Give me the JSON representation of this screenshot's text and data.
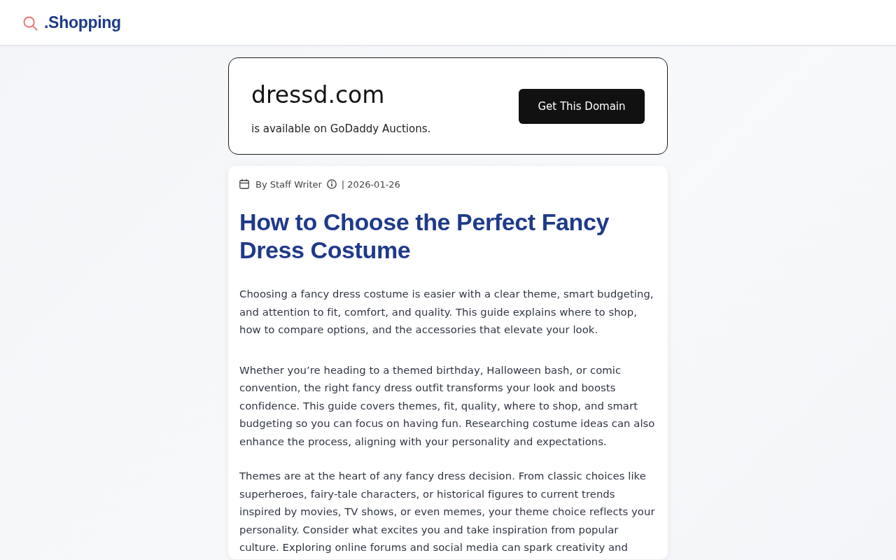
{
  "header": {
    "logo_text": ".Shopping"
  },
  "domain_banner": {
    "domain": "dressd.com",
    "subtitle": "is available on GoDaddy Auctions.",
    "button": "Get This Domain"
  },
  "article": {
    "author": "By Staff Writer",
    "date": "| 2026-01-26",
    "title": "How to Choose the Perfect Fancy Dress Costume",
    "summary": "Choosing a fancy dress costume is easier with a clear theme, smart budgeting, and attention to fit, comfort, and quality. This guide explains where to shop, how to compare options, and the accessories that elevate your look.",
    "paragraphs": [
      "Whether you’re heading to a themed birthday, Halloween bash, or comic convention, the right fancy dress outfit transforms your look and boosts confidence. This guide covers themes, fit, quality, where to shop, and smart budgeting so you can focus on having fun. Researching costume ideas can also enhance the process, aligning with your personality and expectations.",
      "Themes are at the heart of any fancy dress decision. From classic choices like superheroes, fairy-tale characters, or historical figures to current trends inspired by movies, TV shows, or even memes, your theme choice reflects your personality. Consider what excites you and take inspiration from popular culture. Exploring online forums and social media can spark creativity and"
    ]
  }
}
